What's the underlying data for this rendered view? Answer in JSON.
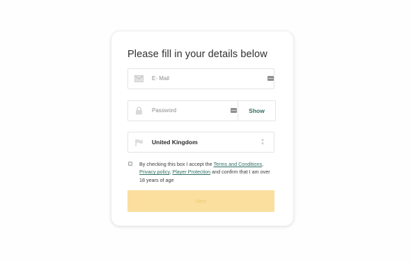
{
  "form": {
    "title": "Please fill in your details below",
    "email": {
      "placeholder": "E- Mail"
    },
    "password": {
      "placeholder": "Password",
      "show_label": "Show"
    },
    "country": {
      "selected": "United Kingdom"
    },
    "consent": {
      "prefix": "By checking this box I accept the",
      "terms_link": "Terms and Conditions",
      "comma1": ",",
      "privacy_link": "Privacy policy",
      "comma2": ",",
      "protection_link": "Player Protection",
      "suffix": "and confirm that I am over 18 years of age"
    },
    "next_label": "Next"
  },
  "colors": {
    "accent": "#2e6e62",
    "button_disabled_bg": "#fbdf9e",
    "button_disabled_text": "#ecc877"
  }
}
